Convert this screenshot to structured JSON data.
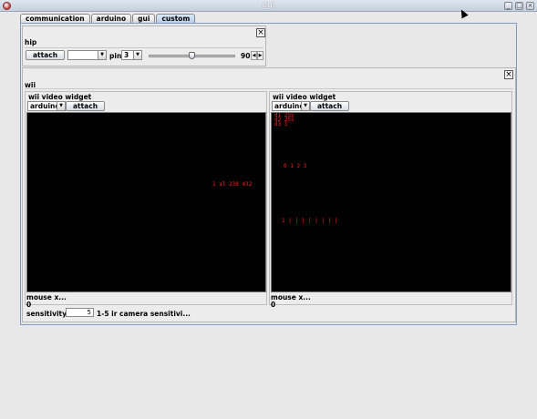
{
  "window": {
    "title": "gui"
  },
  "tabs": [
    "communication",
    "arduino",
    "gui",
    "custom"
  ],
  "hip": {
    "title": "hip",
    "attach_label": "attach",
    "board_value": "",
    "pin_label": "pin",
    "pin_value": "3",
    "slider_value": "90",
    "slider_fraction": 0.5
  },
  "wii": {
    "title": "wii",
    "widgets": [
      {
        "title": "wii  video widget",
        "controller": "arduino",
        "attach_label": "attach",
        "overlay": [
          {
            "text": "1 sl 238 432"
          }
        ],
        "status": "mouse x...",
        "value": "0"
      },
      {
        "title": "wii  video widget",
        "controller": "arduino",
        "attach_label": "attach",
        "overlay": [
          {
            "text": "d1 255"
          },
          {
            "text": "d2 255"
          },
          {
            "text": "d3 1"
          },
          {
            "text": "0   1   2 3"
          },
          {
            "text": "1   |   |   |   |   |   |   |   |"
          }
        ],
        "status": "mouse x...",
        "value": "0"
      }
    ],
    "sensitivity_label": "sensitivity:",
    "sensitivity_value": "5",
    "sensitivity_hint": "1-5 ir camera sensitivi..."
  },
  "colors": {
    "overlay": "#ff2020",
    "screen": "#000000",
    "active_tab": "#b9cde8"
  }
}
